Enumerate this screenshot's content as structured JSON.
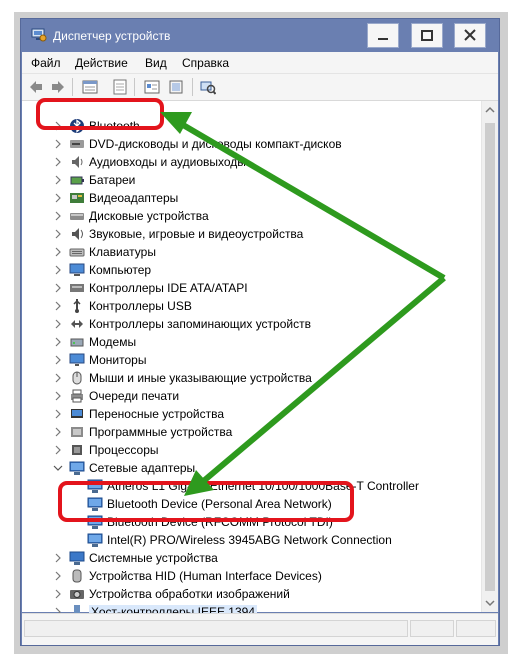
{
  "window": {
    "title": "Диспетчер устройств"
  },
  "menu": [
    "Файл",
    "Действие",
    "Вид",
    "Справка"
  ],
  "toolbar": [
    "back-icon",
    "forward-icon",
    "properties-icon",
    "help-icon",
    "action-icon",
    "scan-hardware-icon"
  ],
  "tree": [
    {
      "label": "Bluetooth",
      "icon": "bluetooth-icon",
      "expanded": false,
      "highlighted": true
    },
    {
      "label": "DVD-дисководы и дисководы компакт-дисков",
      "icon": "dvd-icon",
      "expanded": false
    },
    {
      "label": "Аудиовходы и аудиовыходы",
      "icon": "audio-icon",
      "expanded": false
    },
    {
      "label": "Батареи",
      "icon": "battery-icon",
      "expanded": false
    },
    {
      "label": "Видеоадаптеры",
      "icon": "display-adapter-icon",
      "expanded": false
    },
    {
      "label": "Дисковые устройства",
      "icon": "disk-icon",
      "expanded": false
    },
    {
      "label": "Звуковые, игровые и видеоустройства",
      "icon": "sound-icon",
      "expanded": false
    },
    {
      "label": "Клавиатуры",
      "icon": "keyboard-icon",
      "expanded": false
    },
    {
      "label": "Компьютер",
      "icon": "computer-icon",
      "expanded": false
    },
    {
      "label": "Контроллеры IDE ATA/ATAPI",
      "icon": "ide-icon",
      "expanded": false
    },
    {
      "label": "Контроллеры USB",
      "icon": "usb-icon",
      "expanded": false
    },
    {
      "label": "Контроллеры запоминающих устройств",
      "icon": "storage-icon",
      "expanded": false
    },
    {
      "label": "Модемы",
      "icon": "modem-icon",
      "expanded": false
    },
    {
      "label": "Мониторы",
      "icon": "monitor-icon",
      "expanded": false
    },
    {
      "label": "Мыши и иные указывающие устройства",
      "icon": "mouse-icon",
      "expanded": false
    },
    {
      "label": "Очереди печати",
      "icon": "printer-icon",
      "expanded": false
    },
    {
      "label": "Переносные устройства",
      "icon": "portable-icon",
      "expanded": false
    },
    {
      "label": "Программные устройства",
      "icon": "software-icon",
      "expanded": false
    },
    {
      "label": "Процессоры",
      "icon": "cpu-icon",
      "expanded": false
    },
    {
      "label": "Сетевые адаптеры",
      "icon": "network-icon",
      "expanded": true
    },
    {
      "label": "Atheros L1 Gigabit Ethernet 10/100/1000Base-T Controller",
      "icon": "network-icon",
      "child": true
    },
    {
      "label": "Bluetooth Device (Personal Area Network)",
      "icon": "network-icon",
      "child": true,
      "highlighted": true
    },
    {
      "label": "Bluetooth Device (RFCOMM Protocol TDI)",
      "icon": "network-icon",
      "child": true,
      "highlighted": true
    },
    {
      "label": "Intel(R) PRO/Wireless 3945ABG Network Connection",
      "icon": "network-icon",
      "child": true
    },
    {
      "label": "Системные устройства",
      "icon": "system-icon",
      "expanded": false
    },
    {
      "label": "Устройства HID (Human Interface Devices)",
      "icon": "hid-icon",
      "expanded": false
    },
    {
      "label": "Устройства обработки изображений",
      "icon": "camera-icon",
      "expanded": false
    },
    {
      "label": "Хост-контроллеры IEEE 1394",
      "icon": "ieee1394-icon",
      "expanded": false,
      "selected": true
    }
  ],
  "annotation": {
    "arrow_color": "#2e9a1e",
    "highlight_color": "#e3141c"
  }
}
